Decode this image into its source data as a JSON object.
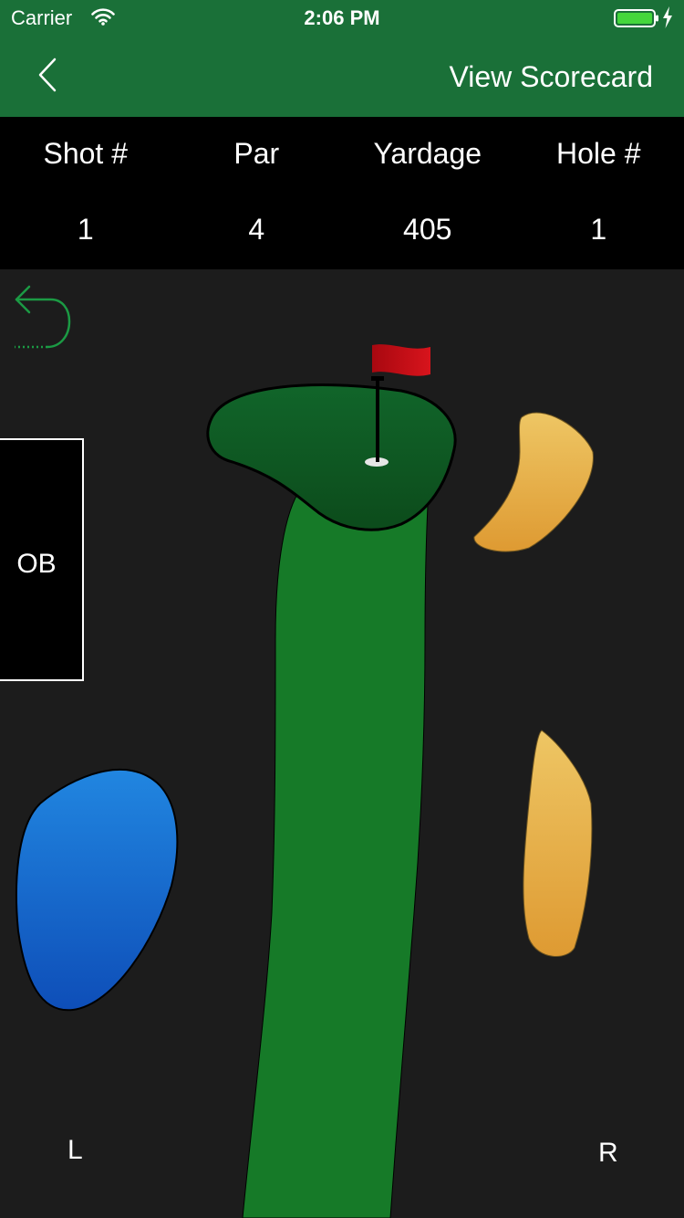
{
  "status_bar": {
    "carrier": "Carrier",
    "time": "2:06 PM",
    "battery_color": "#44d63c"
  },
  "nav": {
    "action_label": "View Scorecard",
    "back_icon": "chevron-left-icon",
    "bar_color": "#1a7038"
  },
  "stats": {
    "headers": [
      "Shot #",
      "Par",
      "Yardage",
      "Hole #"
    ],
    "values": [
      "1",
      "4",
      "405",
      "1"
    ]
  },
  "course": {
    "undo_icon": "undo-arrow-icon",
    "ob_label": "OB",
    "left_label": "L",
    "right_label": "R",
    "colors": {
      "fairway": "#167a28",
      "green": "#0f5a20",
      "water": "#1c6ad4",
      "bunker": "#e8b550",
      "flag": "#cc1018",
      "background": "#1c1c1c"
    }
  }
}
